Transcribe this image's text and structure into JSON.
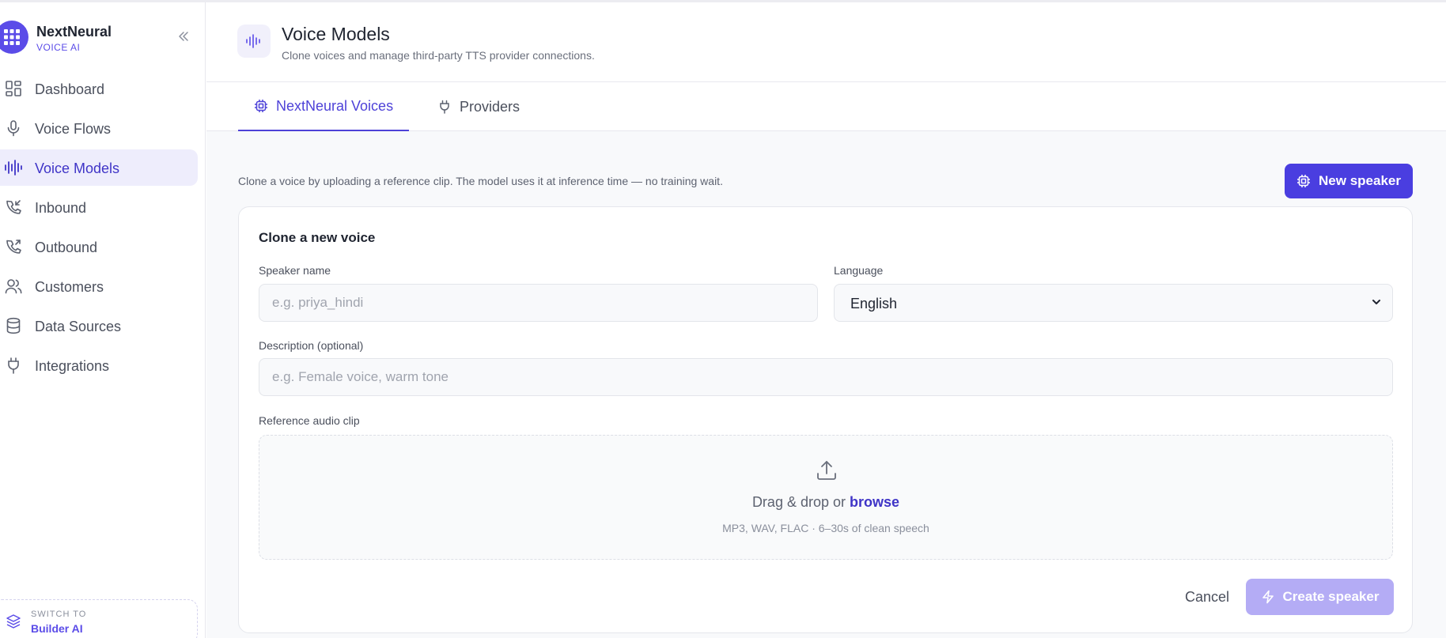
{
  "brand": {
    "name": "NextNeural",
    "subtitle": "VOICE AI"
  },
  "sidebar": {
    "items": [
      {
        "label": "Dashboard",
        "icon": "dashboard-icon",
        "active": false
      },
      {
        "label": "Voice Flows",
        "icon": "microphone-icon",
        "active": false
      },
      {
        "label": "Voice Models",
        "icon": "waveform-icon",
        "active": true
      },
      {
        "label": "Inbound",
        "icon": "phone-incoming-icon",
        "active": false
      },
      {
        "label": "Outbound",
        "icon": "phone-outgoing-icon",
        "active": false
      },
      {
        "label": "Customers",
        "icon": "users-icon",
        "active": false
      },
      {
        "label": "Data Sources",
        "icon": "database-icon",
        "active": false
      },
      {
        "label": "Integrations",
        "icon": "plug-icon",
        "active": false
      }
    ],
    "switch": {
      "small": "SWITCH TO",
      "main": "Builder AI"
    }
  },
  "header": {
    "title": "Voice Models",
    "subtitle": "Clone voices and manage third-party TTS provider connections."
  },
  "tabs": [
    {
      "label": "NextNeural Voices",
      "icon": "chip-icon",
      "active": true
    },
    {
      "label": "Providers",
      "icon": "plug-icon",
      "active": false
    }
  ],
  "content": {
    "intro": "Clone a voice by uploading a reference clip. The model uses it at inference time — no training wait.",
    "new_button": "New speaker"
  },
  "form": {
    "title": "Clone a new voice",
    "speaker_name": {
      "label": "Speaker name",
      "placeholder": "e.g. priya_hindi",
      "value": ""
    },
    "language": {
      "label": "Language",
      "value": "English"
    },
    "description": {
      "label": "Description (optional)",
      "placeholder": "e.g. Female voice, warm tone",
      "value": ""
    },
    "audio": {
      "label": "Reference audio clip",
      "drop_text": "Drag & drop or",
      "browse": "browse",
      "hint": "MP3, WAV, FLAC · 6–30s of clean speech"
    },
    "cancel": "Cancel",
    "create": "Create speaker"
  },
  "colors": {
    "accent": "#4a3ee0",
    "accent_light": "#b4acf5",
    "active_bg": "#eeedfc"
  }
}
